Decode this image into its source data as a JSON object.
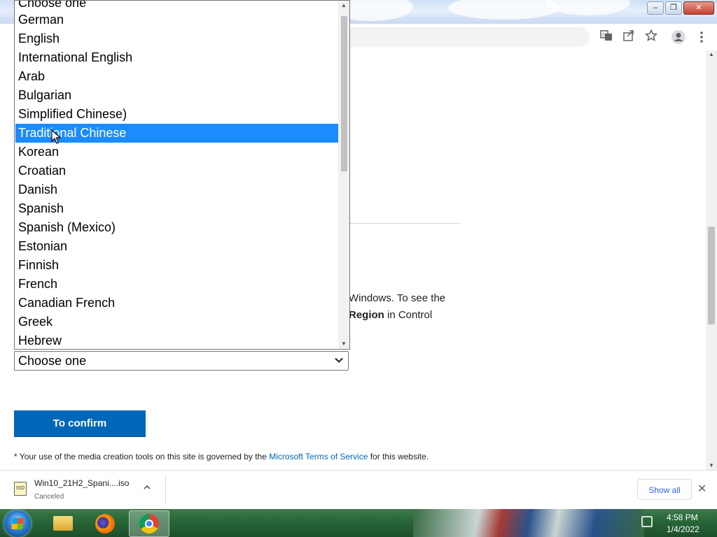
{
  "window": {
    "minimize_glyph": "–",
    "restore_glyph": "❐",
    "close_glyph": "✕"
  },
  "toolbar": {
    "icons": [
      "translate-icon",
      "share-icon",
      "bookmark-star-icon",
      "profile-icon",
      "menu-icon"
    ]
  },
  "page": {
    "region_text_line1": "Windows. To see the",
    "region_text_bold": "Region",
    "region_text_line2_rest": " in Control",
    "select_value": "Choose one",
    "confirm_label": "To confirm",
    "tos_prefix": "* Your use of the media creation tools on this site is governed by the ",
    "tos_link": "Microsoft Terms of Service",
    "tos_suffix": " for this website."
  },
  "dropdown": {
    "options": [
      "Choose one",
      "German",
      "English",
      "International English",
      "Arab",
      "Bulgarian",
      "Simplified Chinese)",
      "Traditional Chinese",
      "Korean",
      "Croatian",
      "Danish",
      "Spanish",
      "Spanish (Mexico)",
      "Estonian",
      "Finnish",
      "French",
      "Canadian French",
      "Greek",
      "Hebrew"
    ],
    "highlighted": "Traditional Chinese"
  },
  "downloads": {
    "file_name": "Win10_21H2_Spani....iso",
    "status": "Canceled",
    "file_icon_label": "ISO",
    "show_all_label": "Show all",
    "close_glyph": "✕"
  },
  "taskbar": {
    "apps": [
      "windows-explorer",
      "firefox",
      "chrome"
    ],
    "time": "4:58 PM",
    "date": "1/4/2022"
  },
  "colors": {
    "accent": "#0067b8",
    "selection": "#1a8cff",
    "link": "#0067b8"
  }
}
